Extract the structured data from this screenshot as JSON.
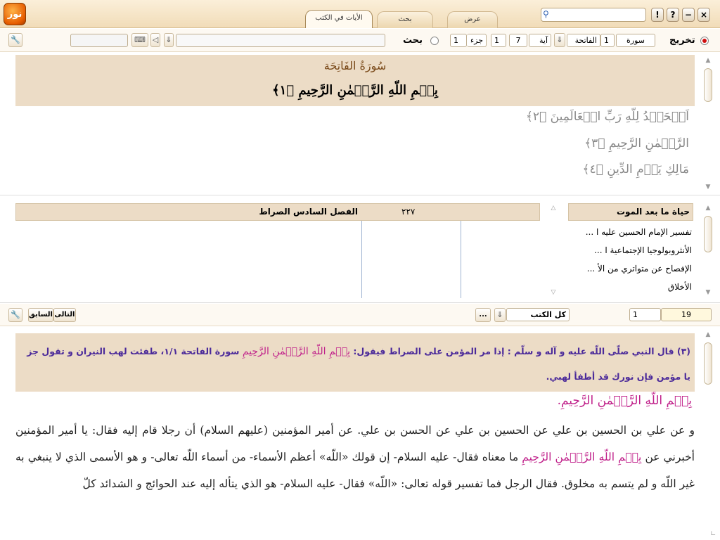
{
  "app": {
    "logo_text": "نور"
  },
  "tabs": [
    {
      "label": "الأيات في الكتب",
      "active": true
    },
    {
      "label": "بحث",
      "active": false
    },
    {
      "label": "عرض",
      "active": false
    }
  ],
  "window_controls": {
    "close": "×",
    "minimize": "−",
    "help": "?",
    "info": "!"
  },
  "search": {
    "placeholder": ""
  },
  "toolbar": {
    "takhreej_label": "تخريج",
    "surah_label": "سورة",
    "surah_number": "1",
    "surah_name": "الفاتحة",
    "ayah_label": "آية",
    "ayah_number": "7",
    "ayah_from": "1",
    "juz_label": "جزء",
    "juz_number": "1",
    "search_label": "بحث"
  },
  "quran": {
    "surah_title": "سُورَةُ الفَاتِحَة",
    "basmala": "بِسۡمِ اللّهِ الرَّحۡمٰنِ الرَّحِيمِ ﴿١﴾",
    "ayat": [
      "اَلۡحَمۡدُ لِلّهِ رَبِّ الۡعَالَمِينَ ﴿٢﴾",
      "الرَّحۡمٰنِ الرَّحِيمِ ﴿٣﴾",
      "مَالِكِ يَوۡمِ الدِّينِ ﴿٤﴾"
    ]
  },
  "results": {
    "title": "الفصل السادس الصراط",
    "page": "٢٢٧"
  },
  "books": {
    "header": "حياة ما بعد الموت",
    "items": [
      "تفسير الإمام الحسين عليه ا ...",
      "الأنثروبولوجيا الإجتماعية ا ...",
      "الإفصاح عن متواتري من الأ ...",
      "الأخلاق"
    ]
  },
  "bottom_bar": {
    "next_label": "التالى",
    "prev_label": "السابق",
    "more_label": "...",
    "all_books_label": "كل الكتب",
    "page_from": "1",
    "page_to": "19"
  },
  "hadith": {
    "text_start": "(٣) قال النبي صلّى اللّه عليه و آله و سلّم : إذا مر المؤمن على الصراط فيقول: ",
    "basmala_pink": "بِسۡمِ اللّهِ الرَّحۡمٰنِ الرَّحِيمِ",
    "text_mid": " سورة الفاتحة ١/١، طفئت لهب النيران و تقول جز يا مؤمن فإن نورك قد أطفأ لهبي."
  },
  "body": {
    "basmala": "بِسۡمِ اللّهِ الرَّحۡمٰنِ الرَّحِيمِ.",
    "para_1": "و عن علي بن الحسين بن علي عن الحسين بن علي عن الحسن بن علي. عن أمير المؤمنين (عليهم السلام) أن رجلا قام إليه فقال: يا أمير المؤمنين أخبرني عن ",
    "basmala_inline": "بِسۡمِ اللّهِ الرَّحۡمٰنِ الرَّحِيمِ",
    "para_2": " ما معناه فقال- عليه السلام- إن قولك «اللّه» أعظم الأسماء- من أسماء اللّه تعالى- و هو الأسمى الذي لا ينبغي به غير اللّه و لم يتسم به مخلوق. فقال الرجل فما تفسير قوله تعالى: «اللّه» فقال- عليه السلام- هو الذي يتأله إليه عند الحوائج و الشدائد كلّ"
  },
  "colors": {
    "accent_bar": "#ecdcc6",
    "pink": "#c0208a",
    "purple": "#4b2a9a"
  }
}
